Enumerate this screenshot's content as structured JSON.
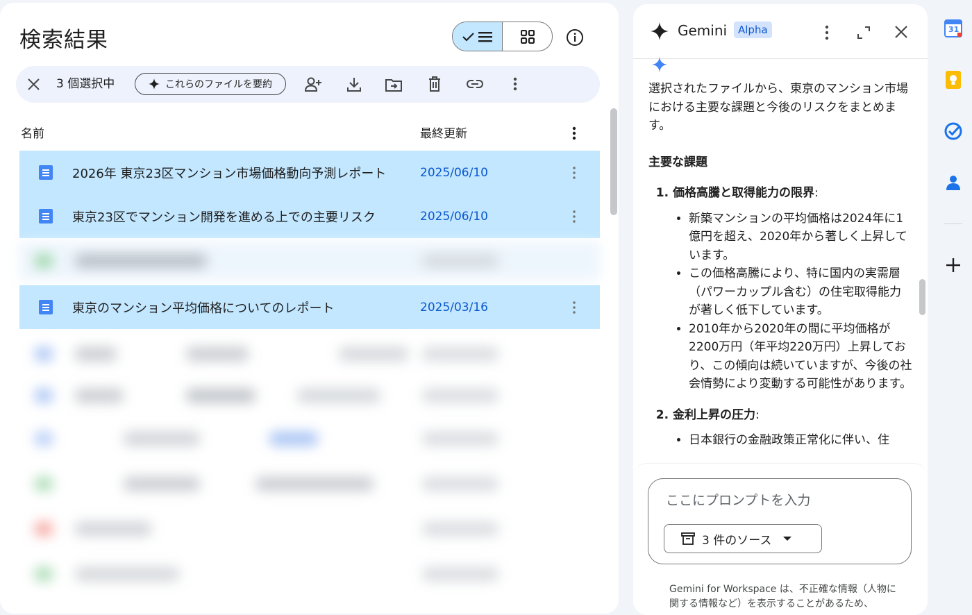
{
  "files_panel": {
    "title": "検索結果",
    "selection": {
      "count_label": "3 個選択中",
      "summarize_label": "これらのファイルを要約"
    },
    "columns": {
      "name": "名前",
      "modified": "最終更新"
    },
    "selected_rows": [
      {
        "name": "2026年 東京23区マンション市場価格動向予測レポート",
        "date": "2025/06/10"
      },
      {
        "name": "東京23区でマンション開発を進める上での主要リスク",
        "date": "2025/06/10"
      },
      {
        "name": "東京のマンション平均価格についてのレポート",
        "date": "2025/03/16"
      }
    ],
    "icons": {
      "close": "close-icon",
      "sparkle": "sparkle-icon",
      "share": "add-person-icon",
      "download": "download-icon",
      "move": "move-to-folder-icon",
      "delete": "trash-icon",
      "link": "link-icon",
      "more": "more-vert-icon",
      "info": "info-icon",
      "list_view": "list-view-icon",
      "grid_view": "grid-view-icon",
      "doc": "google-docs-icon"
    },
    "colors": {
      "selected_row": "#c2e7ff",
      "date_text": "#0b57d0",
      "doc_icon": "#4285f4"
    }
  },
  "gemini_panel": {
    "title": "Gemini",
    "badge": "Alpha",
    "intro": "選択されたファイルから、東京のマンション市場における主要な課題と今後のリスクをまとめます。",
    "section_title": "主要な課題",
    "issues": [
      {
        "title": "価格高騰と取得能力の限界",
        "bullets": [
          "新築マンションの平均価格は2024年に1億円を超え、2020年から著しく上昇しています。",
          "この価格高騰により、特に国内の実需層（パワーカップル含む）の住宅取得能力が著しく低下しています。",
          "2010年から2020年の間に平均価格が2200万円（年平均220万円）上昇しており、この傾向は続いていますが、今後の社会情勢により変動する可能性があります。"
        ]
      },
      {
        "title": "金利上昇の圧力",
        "bullets": [
          "日本銀行の金融政策正常化に伴い、住"
        ]
      }
    ],
    "prompt_placeholder": "ここにプロンプトを入力",
    "sources_label": "3 件のソース",
    "disclaimer": "Gemini for Workspace は、不正確な情報（人物に関する情報など）を表示することがあるため、"
  },
  "rail": {
    "icons": [
      "google-calendar-icon",
      "google-keep-icon",
      "google-tasks-icon",
      "google-contacts-icon",
      "add-icon"
    ],
    "calendar_day": "31"
  }
}
